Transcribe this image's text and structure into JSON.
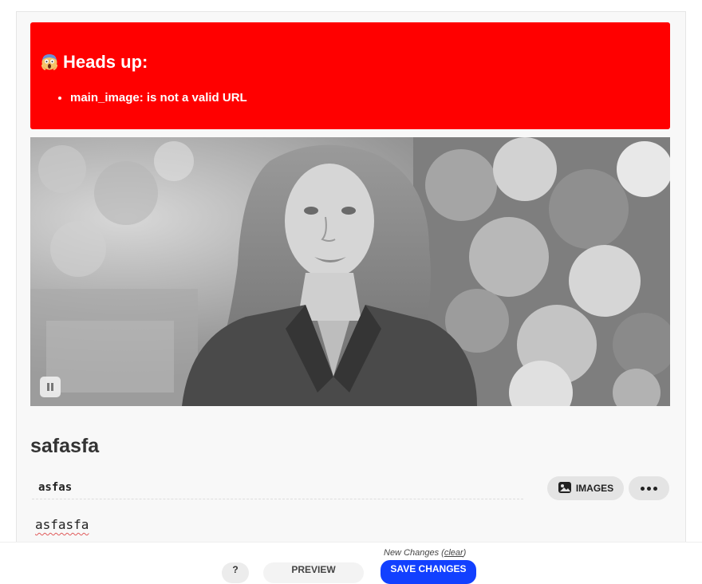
{
  "alert": {
    "title": "Heads up:",
    "icon": "screaming-face-icon",
    "background": "#ff0000",
    "errors": [
      "main_image: is not a valid URL"
    ]
  },
  "cover_image": {
    "alt": "Main image",
    "pause_icon": "pause-icon"
  },
  "post": {
    "title": "safasfa",
    "tags": "asfas",
    "body": "asfasfa"
  },
  "toolbar": {
    "images_label": "IMAGES",
    "images_icon": "image-icon",
    "more_icon": "more-icon"
  },
  "footer": {
    "new_changes_label": "New Changes",
    "clear_label": "clear",
    "help_label": "?",
    "preview_label": "PREVIEW",
    "save_label": "SAVE CHANGES",
    "save_color": "#1240ff"
  }
}
